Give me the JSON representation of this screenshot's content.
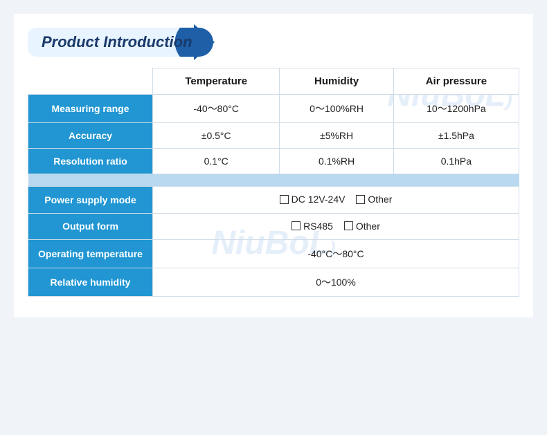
{
  "title": "Product Introduction",
  "watermark": "NiuBoL",
  "table": {
    "columns": [
      "",
      "Temperature",
      "Humidity",
      "Air pressure"
    ],
    "rows": [
      {
        "label": "Measuring range",
        "temperature": "-40～80°C",
        "humidity": "0～100%RH",
        "airpressure": "10～1200hPa"
      },
      {
        "label": "Accuracy",
        "temperature": "±0.5°C",
        "humidity": "±5%RH",
        "airpressure": "±1.5hPa"
      },
      {
        "label": "Resolution ratio",
        "temperature": "0.1°C",
        "humidity": "0.1%RH",
        "airpressure": "0.1hPa"
      }
    ]
  },
  "info_rows": [
    {
      "label": "Power supply mode",
      "value": "DC 12V-24V",
      "extra": "Other",
      "type": "checkbox2"
    },
    {
      "label": "Output form",
      "value": "RS485",
      "extra": "Other",
      "type": "checkbox2"
    },
    {
      "label": "Operating temperature",
      "value": "-40°C～80°C",
      "type": "text"
    },
    {
      "label": "Relative humidity",
      "value": "0～100%",
      "type": "text"
    }
  ]
}
